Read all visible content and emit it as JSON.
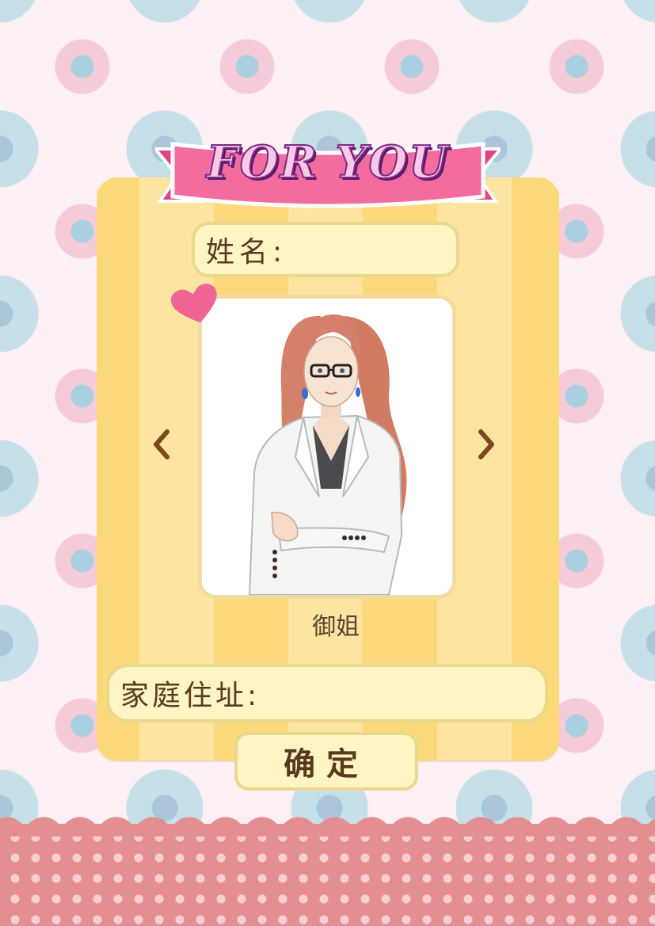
{
  "banner": {
    "title": "FOR YOU"
  },
  "form": {
    "name_label": "姓名:",
    "address_label": "家庭住址:",
    "confirm_label": "确定"
  },
  "character": {
    "name": "御姐"
  },
  "colors": {
    "banner_pink": "#f0679a",
    "card_yellow": "#fcd97a",
    "field_bg": "#fff4c4",
    "heart": "#f06496",
    "arrow": "#7a4a1c"
  }
}
